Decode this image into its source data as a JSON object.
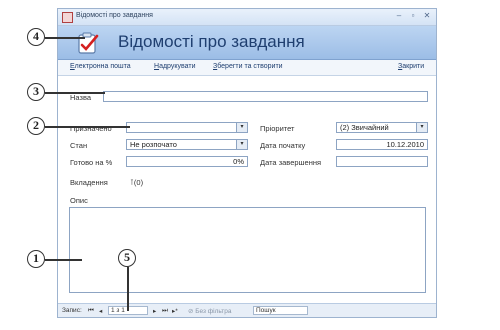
{
  "window": {
    "title": "Відомості про завдання",
    "buttons": {
      "minimize": "–",
      "restore": "▫",
      "close": "✕"
    }
  },
  "header": {
    "title": "Відомості про завдання",
    "icon": "task-checklist-icon"
  },
  "toolbar": {
    "email": "Електронна пошта",
    "print": "Надрукувати",
    "save_new": "Зберегти та створити",
    "close": "Закрити"
  },
  "form": {
    "name_label": "Назва",
    "name_value": "",
    "assigned_label": "Призначено",
    "assigned_value": "",
    "status_label": "Стан",
    "status_value": "Не розпочато",
    "percent_label": "Готово на %",
    "percent_value": "0%",
    "attachments_label": "Вкладення",
    "attachments_value": "(0)",
    "priority_label": "Пріоритет",
    "priority_value": "(2) Звичайний",
    "start_label": "Дата початку",
    "start_value": "10.12.2010",
    "due_label": "Дата завершення",
    "due_value": "",
    "description_label": "Опис"
  },
  "statusbar": {
    "record_label": "Запис:",
    "record_value": "1 з 1",
    "filter_label": "Без фільтра",
    "search_label": "Пошук"
  },
  "callouts": [
    "1",
    "2",
    "3",
    "4",
    "5"
  ]
}
